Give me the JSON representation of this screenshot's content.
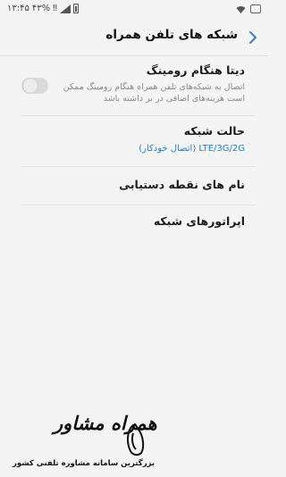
{
  "statusbar": {
    "time": "۱۳:۴۵",
    "battery": "۴۳%",
    "extra": "‼",
    "icons": [
      "image-icon",
      "wifi-icon",
      "battery-icon",
      "signal-icon"
    ]
  },
  "header": {
    "title": "شبکه های تلفن همراه",
    "back_icon": "chevron-back-icon"
  },
  "settings": {
    "data_roaming": {
      "title": "دیتا هنگام رومینگ",
      "description": "اتصال به شبکه‌های تلفن همراه هنگام رومینگ ممکن است هزینه‌های اضافی در بر داشته باشد",
      "toggle_state": "off"
    },
    "network_mode": {
      "title": "حالت شبکه",
      "value": "LTE/3G/2G (اتصال خودکار)"
    },
    "access_point_names": {
      "title": "نام های نقطه دستیابی"
    },
    "network_operators": {
      "title": "اپراتورهای شبکه"
    }
  },
  "watermark": {
    "brand": "همراه مشاور",
    "tagline": "بزرگترین سامانه مشاوره تلفنی کشور"
  },
  "colors": {
    "background": "#f4f4f4",
    "accent": "#1b7fc4",
    "secondary_text": "#8a8a8a",
    "back_arrow": "#3d7fbf"
  }
}
